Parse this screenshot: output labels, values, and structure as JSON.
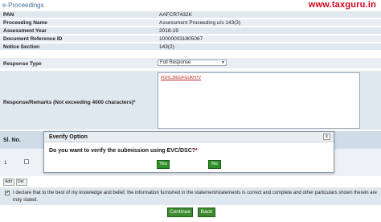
{
  "header": {
    "title": "e-Proceedings",
    "watermark": "www.taxguru.in"
  },
  "form": {
    "rows": [
      {
        "label": "PAN",
        "value": "AAFCR7432K"
      },
      {
        "label": "Proceeding Name",
        "value": "Assessment Proceeding u/s 143(3)"
      },
      {
        "label": "Assessment Year",
        "value": "2018-19"
      },
      {
        "label": "Document Reference ID",
        "value": "100000031805067"
      },
      {
        "label": "Notice Section",
        "value": "143(2)"
      }
    ],
    "response_type": {
      "label": "Response Type",
      "selected": "Full Response"
    },
    "remarks": {
      "label": "Response/Remarks (Not exceeding 4000 characters)*",
      "value": "FGHLJ9GGFGUKH7V"
    }
  },
  "attachments": {
    "col_sl_no": "Sl. No.",
    "rows": [
      {
        "num": "1"
      }
    ],
    "add_label": "Add",
    "delete_label": "Del"
  },
  "declaration": {
    "checked": true,
    "text": "I declare that to the best of my knowledge and belief, the information furnished in the statement/statements is correct and complete and other particulars shown therein are truly stated."
  },
  "actions": {
    "continue_label": "Continue",
    "back_label": "Back"
  },
  "modal": {
    "title": "Everify Option",
    "close_label": "x",
    "question": "Do you want to verify the submission using EVC/DSC?",
    "required_mark": "*",
    "yes_label": "Yes",
    "no_label": "No"
  },
  "colors": {
    "accent_green": "#3c8a2e",
    "watermark_red": "#d0021b",
    "row_bg": "#dfe7ef"
  }
}
